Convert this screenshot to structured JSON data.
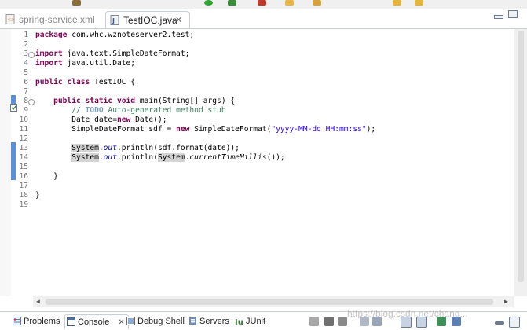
{
  "colors": {
    "keyword": "#7f0055",
    "comment": "#3f7f5f",
    "todo_tag": "#7f9fbf",
    "string": "#2a00ff",
    "field": "#0000c0",
    "line_number": "#787878",
    "ruler_marker": "#5b8fd6",
    "occurrence_highlight": "#d4d4d4"
  },
  "editor": {
    "tabs": [
      {
        "label": "spring-service.xml",
        "icon": "xml-file-icon",
        "active": false
      },
      {
        "label": "TestIOC.java",
        "icon": "java-file-icon",
        "active": true,
        "close": "✕"
      }
    ],
    "lines": [
      {
        "n": "1",
        "tokens": [
          {
            "t": "package",
            "c": "kw"
          },
          {
            "t": " com.whc.wznoteserver2.test;"
          }
        ]
      },
      {
        "n": "2",
        "tokens": []
      },
      {
        "n": "3",
        "fold": true,
        "tokens": [
          {
            "t": "import",
            "c": "kw"
          },
          {
            "t": " java.text.SimpleDateFormat;"
          }
        ]
      },
      {
        "n": "4",
        "tokens": [
          {
            "t": "import",
            "c": "kw"
          },
          {
            "t": " java.util.Date;"
          }
        ]
      },
      {
        "n": "5",
        "tokens": []
      },
      {
        "n": "6",
        "tokens": [
          {
            "t": "public",
            "c": "kw"
          },
          {
            "t": " "
          },
          {
            "t": "class",
            "c": "kw"
          },
          {
            "t": " TestIOC {"
          }
        ]
      },
      {
        "n": "7",
        "tokens": []
      },
      {
        "n": "8",
        "fold": true,
        "tokens": [
          {
            "t": "    "
          },
          {
            "t": "public",
            "c": "kw"
          },
          {
            "t": " "
          },
          {
            "t": "static",
            "c": "kw"
          },
          {
            "t": " "
          },
          {
            "t": "void",
            "c": "kw"
          },
          {
            "t": " main(String[] args) {"
          }
        ]
      },
      {
        "n": "9",
        "tokens": [
          {
            "t": "        "
          },
          {
            "t": "// ",
            "c": "cm"
          },
          {
            "t": "TODO",
            "c": "tg"
          },
          {
            "t": " Auto-generated method stub",
            "c": "cm"
          }
        ]
      },
      {
        "n": "10",
        "tokens": [
          {
            "t": "        Date date="
          },
          {
            "t": "new",
            "c": "kw"
          },
          {
            "t": " Date();"
          }
        ]
      },
      {
        "n": "11",
        "tokens": [
          {
            "t": "        SimpleDateFormat sdf = "
          },
          {
            "t": "new",
            "c": "kw"
          },
          {
            "t": " SimpleDateFormat("
          },
          {
            "t": "\"yyyy-MM-dd HH:mm:ss\"",
            "c": "st"
          },
          {
            "t": ");"
          }
        ]
      },
      {
        "n": "12",
        "tokens": []
      },
      {
        "n": "13",
        "tokens": [
          {
            "t": "        "
          },
          {
            "t": "System",
            "c": "hl"
          },
          {
            "t": "."
          },
          {
            "t": "out",
            "c": "fld"
          },
          {
            "t": ".println(sdf.format(date));"
          }
        ]
      },
      {
        "n": "14",
        "tokens": [
          {
            "t": "        "
          },
          {
            "t": "System",
            "c": "hl"
          },
          {
            "t": "."
          },
          {
            "t": "out",
            "c": "fld"
          },
          {
            "t": ".println("
          },
          {
            "t": "System",
            "c": "hl"
          },
          {
            "t": "."
          },
          {
            "t": "currentTimeMillis",
            "c": "mt"
          },
          {
            "t": "());"
          }
        ]
      },
      {
        "n": "15",
        "tokens": []
      },
      {
        "n": "16",
        "tokens": [
          {
            "t": "    }"
          }
        ]
      },
      {
        "n": "17",
        "tokens": []
      },
      {
        "n": "18",
        "tokens": [
          {
            "t": "}"
          }
        ]
      },
      {
        "n": "19",
        "tokens": []
      }
    ]
  },
  "bottom_panel": {
    "tabs": [
      {
        "label": "Problems",
        "icon": "problems-icon",
        "active": false
      },
      {
        "label": "Console",
        "icon": "console-icon",
        "active": true,
        "close": "✕"
      },
      {
        "label": "Debug Shell",
        "icon": "debug-shell-icon",
        "active": false
      },
      {
        "label": "Servers",
        "icon": "servers-icon",
        "active": false
      },
      {
        "label": "JUnit",
        "icon": "junit-icon",
        "active": false
      }
    ]
  },
  "watermark": "https://blog.csdn.net/chang..."
}
